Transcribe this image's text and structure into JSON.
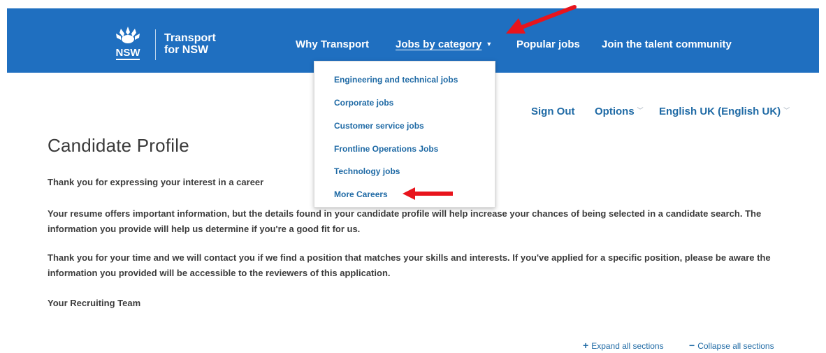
{
  "brand": {
    "govt_label": "NSW",
    "name_line1": "Transport",
    "name_line2": "for NSW",
    "primary_color": "#1f6fc0"
  },
  "nav": {
    "why": "Why Transport",
    "jobs": "Jobs by category",
    "popular": "Popular jobs",
    "talent": "Join the talent community"
  },
  "dropdown": {
    "items": [
      "Engineering and technical jobs",
      "Corporate jobs",
      "Customer service jobs",
      "Frontline Operations Jobs",
      "Technology jobs",
      "More Careers"
    ]
  },
  "utility": {
    "sign_out": "Sign Out",
    "options": "Options",
    "language": "English UK (English UK)"
  },
  "page": {
    "title": "Candidate Profile",
    "intro": "Thank you for expressing your interest in a career",
    "resume_info": "Your resume offers important information, but the details found in your candidate profile will help increase your chances of being selected in a candidate search. The information you provide will help us determine if you're a good fit for us.",
    "thanks": "Thank you for your time and we will contact you if we find a position that matches your skills and interests. If you've applied for a specific position, please be aware the information you provided will be accessible to the reviewers of this application.",
    "signature": "Your Recruiting Team"
  },
  "sections": {
    "expand": "Expand all sections",
    "collapse": "Collapse all sections"
  },
  "annotation_color": "#e8141c"
}
